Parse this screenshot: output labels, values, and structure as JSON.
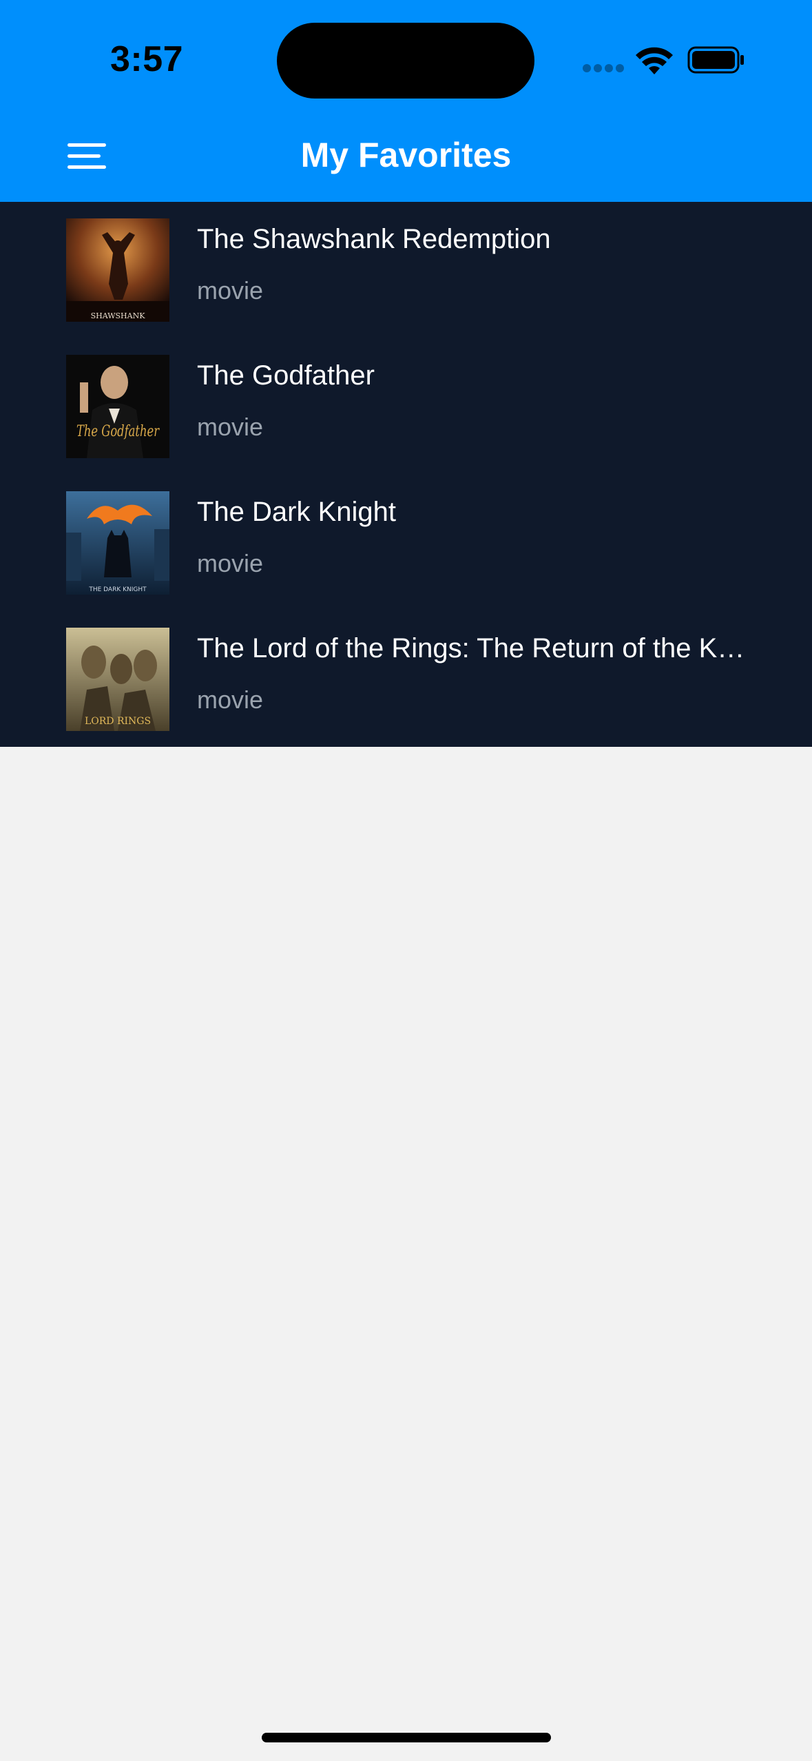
{
  "status_bar": {
    "time": "3:57"
  },
  "nav": {
    "title": "My Favorites",
    "menu_icon": "hamburger-menu-icon"
  },
  "favorites": [
    {
      "title": "The Shawshank Redemption",
      "type": "movie",
      "poster_icon": "shawshank-poster",
      "poster_text": "SHAWSHANK"
    },
    {
      "title": "The Godfather",
      "type": "movie",
      "poster_icon": "godfather-poster",
      "poster_text": "The Godfather"
    },
    {
      "title": "The Dark Knight",
      "type": "movie",
      "poster_icon": "dark-knight-poster",
      "poster_text": "THE DARK KNIGHT"
    },
    {
      "title": "The Lord of the Rings: The Return of the King",
      "type": "movie",
      "poster_icon": "lotr-poster",
      "poster_text": "LORD RINGS"
    }
  ],
  "colors": {
    "header_bg": "#008ffc",
    "list_bg": "#0f192b",
    "page_bg": "#f2f2f2",
    "title_text": "#ffffff",
    "subtitle_text": "#9aa3ae"
  }
}
